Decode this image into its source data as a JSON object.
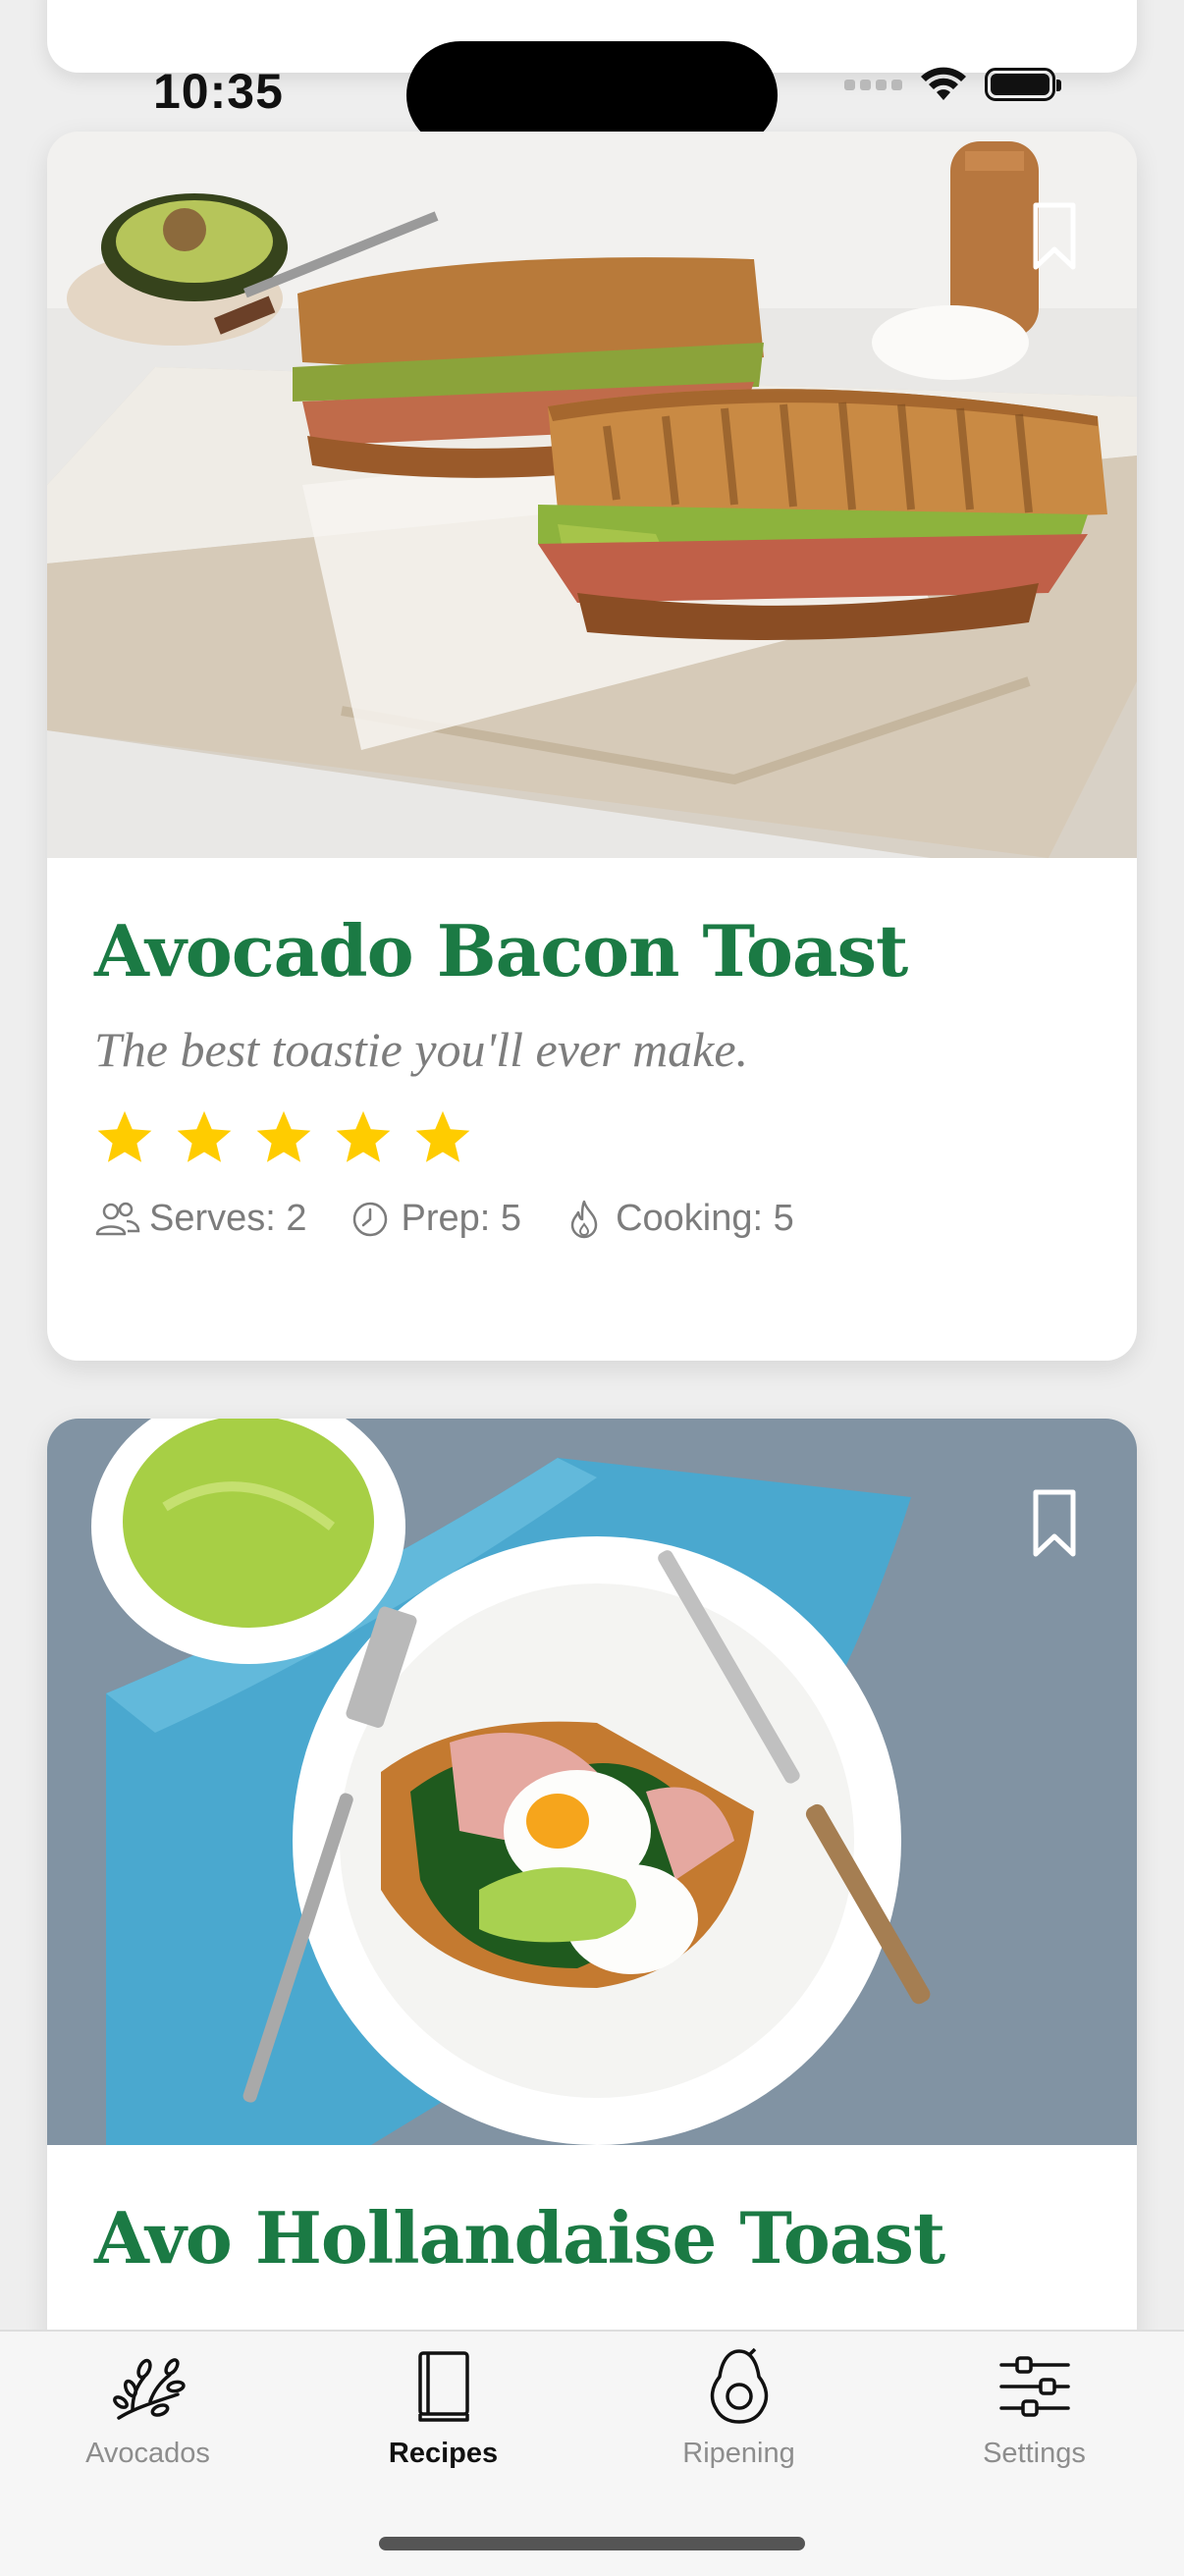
{
  "status_bar": {
    "time": "10:35"
  },
  "recipes": [
    {
      "title": "Avocado Bacon Toast",
      "subtitle": "The best toastie you'll ever make.",
      "rating": 5,
      "serves_label": "Serves: 2",
      "prep_label": "Prep: 5",
      "cooking_label": "Cooking: 5"
    },
    {
      "title": "Avo Hollandaise Toast"
    }
  ],
  "tab_bar": {
    "tabs": [
      {
        "label": "Avocados",
        "icon": "branch-icon",
        "active": false
      },
      {
        "label": "Recipes",
        "icon": "book-icon",
        "active": true
      },
      {
        "label": "Ripening",
        "icon": "avocado-icon",
        "active": false
      },
      {
        "label": "Settings",
        "icon": "sliders-icon",
        "active": false
      }
    ]
  },
  "colors": {
    "title_green": "#1b7a44",
    "star_yellow": "#ffcc00",
    "meta_gray": "#7c7c7c"
  }
}
